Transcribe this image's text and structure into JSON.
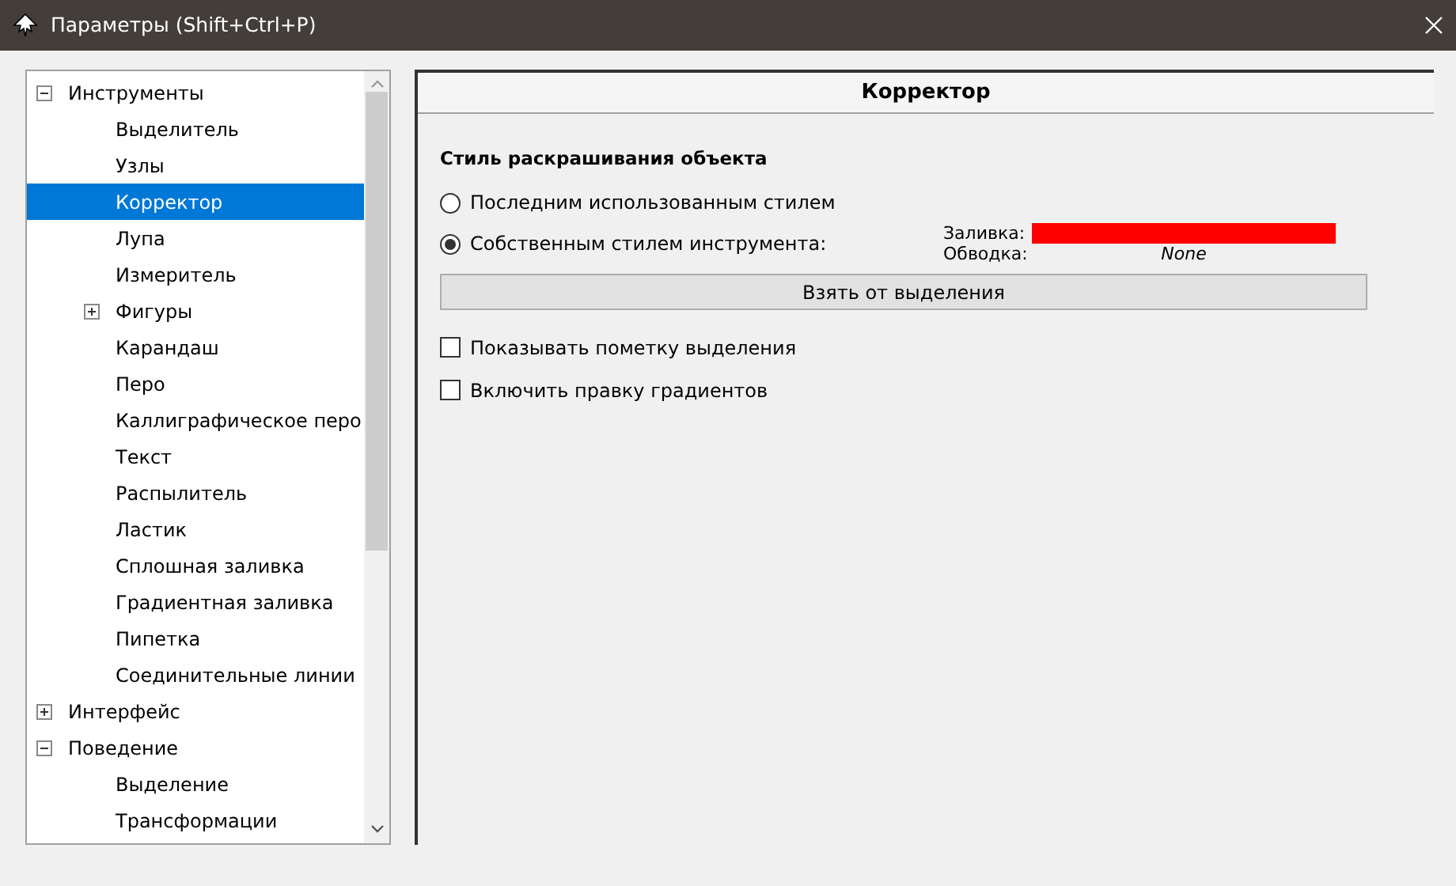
{
  "window": {
    "title": "Параметры (Shift+Ctrl+P)"
  },
  "tree": [
    {
      "label": "Инструменты",
      "expanded": true,
      "selected": false,
      "children": [
        {
          "label": "Выделитель",
          "selected": false
        },
        {
          "label": "Узлы",
          "selected": false
        },
        {
          "label": "Корректор",
          "selected": true
        },
        {
          "label": "Лупа",
          "selected": false
        },
        {
          "label": "Измеритель",
          "selected": false
        },
        {
          "label": "Фигуры",
          "expanded": false,
          "selected": false
        },
        {
          "label": "Карандаш",
          "selected": false
        },
        {
          "label": "Перо",
          "selected": false
        },
        {
          "label": "Каллиграфическое перо",
          "selected": false
        },
        {
          "label": "Текст",
          "selected": false
        },
        {
          "label": "Распылитель",
          "selected": false
        },
        {
          "label": "Ластик",
          "selected": false
        },
        {
          "label": "Сплошная заливка",
          "selected": false
        },
        {
          "label": "Градиентная заливка",
          "selected": false
        },
        {
          "label": "Пипетка",
          "selected": false
        },
        {
          "label": "Соединительные линии",
          "selected": false
        }
      ]
    },
    {
      "label": "Интерфейс",
      "expanded": false,
      "selected": false
    },
    {
      "label": "Поведение",
      "expanded": true,
      "selected": false,
      "children": [
        {
          "label": "Выделение",
          "selected": false
        },
        {
          "label": "Трансформации",
          "selected": false
        }
      ]
    }
  ],
  "panel": {
    "title": "Корректор",
    "section": "Стиль раскрашивания объекта",
    "radios": [
      {
        "label": "Последним использованным стилем",
        "selected": false
      },
      {
        "label": "Собственным стилем инструмента:",
        "selected": true
      }
    ],
    "fill": {
      "label": "Заливка:",
      "color": "#ff0000"
    },
    "stroke": {
      "label": "Обводка:",
      "value": "None"
    },
    "button": "Взять от выделения",
    "checkboxes": [
      {
        "label": "Показывать пометку выделения",
        "checked": false
      },
      {
        "label": "Включить правку градиентов",
        "checked": false
      }
    ]
  }
}
